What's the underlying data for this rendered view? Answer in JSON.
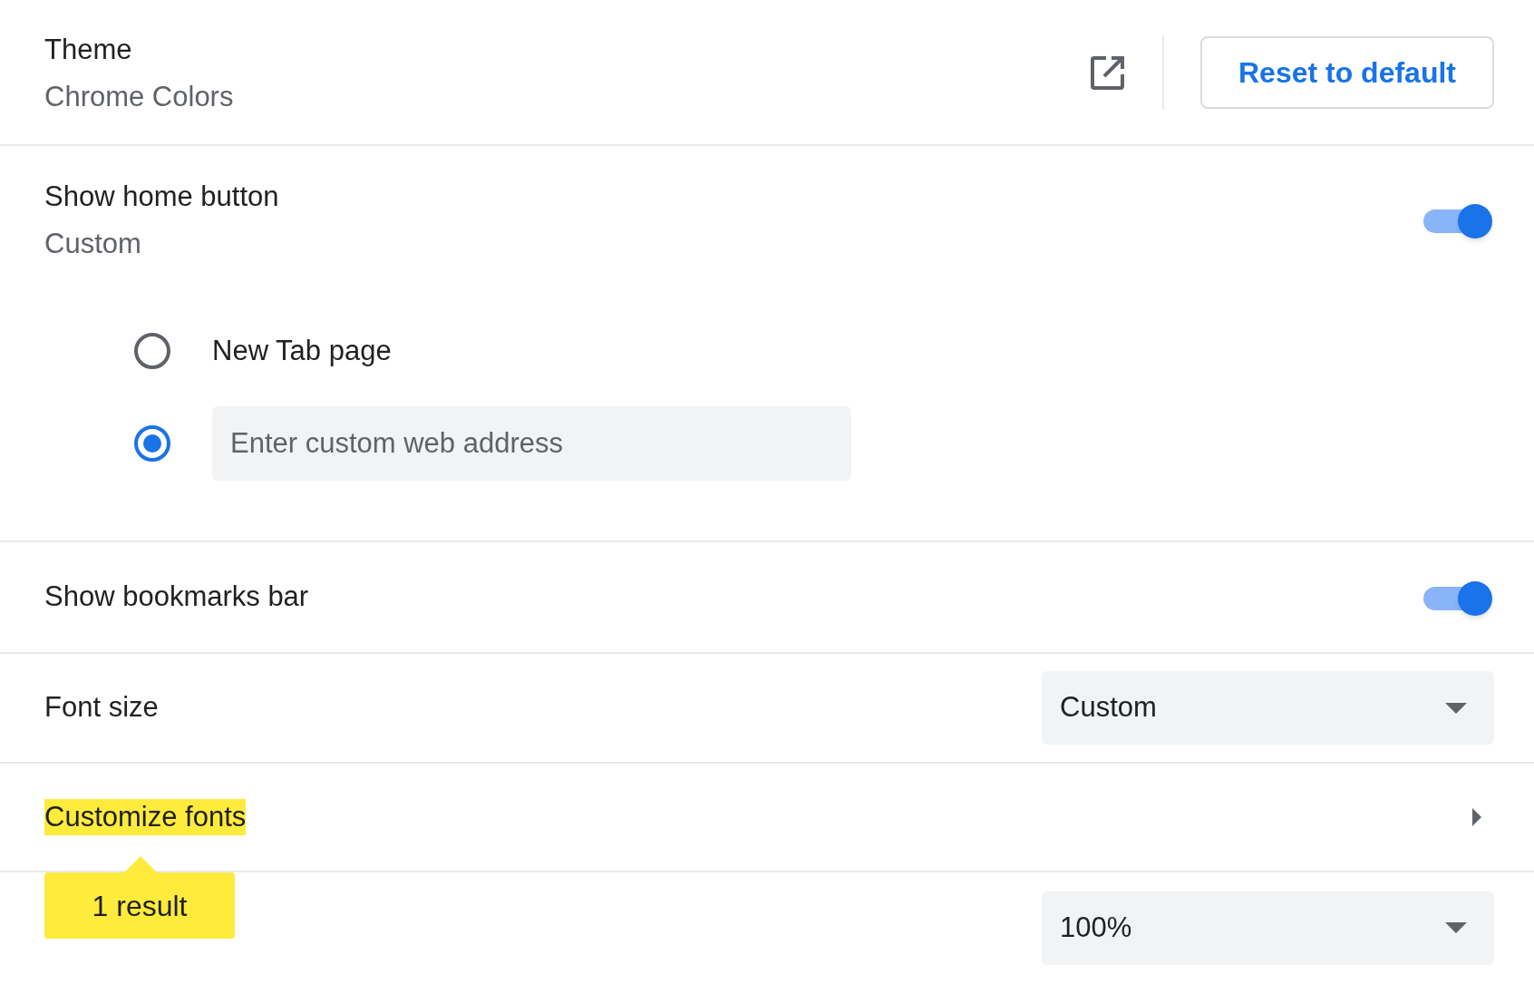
{
  "theme": {
    "title": "Theme",
    "subtitle": "Chrome Colors",
    "button": "Reset to default"
  },
  "home_button": {
    "title": "Show home button",
    "subtitle": "Custom",
    "on": true,
    "options": [
      {
        "kind": "label",
        "label": "New Tab page",
        "selected": false
      },
      {
        "kind": "field",
        "placeholder": "Enter custom web address",
        "selected": true
      }
    ]
  },
  "bookmarks_bar": {
    "title": "Show bookmarks bar",
    "on": true
  },
  "font_size": {
    "title": "Font size",
    "value": "Custom"
  },
  "customize_fonts": {
    "title": "Customize fonts",
    "highlighted": true
  },
  "page_zoom": {
    "value": "100%"
  },
  "search_bubble": {
    "text": "1 result"
  }
}
